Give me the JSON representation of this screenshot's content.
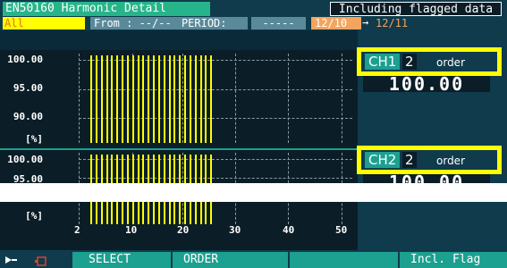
{
  "header": {
    "title": "EN50160 Harmonic Detail",
    "flag_status": "Including flagged data",
    "channel_select": "All",
    "from_label": "From : --/--",
    "period_label": "PERIOD:",
    "period_value": "-----",
    "date_from": "12/10",
    "arrow": "→",
    "date_to": "12/11"
  },
  "graph1": {
    "y_ticks": [
      "100.00",
      "95.00",
      "90.00",
      "[%]"
    ]
  },
  "graph2": {
    "y_ticks": [
      "100.00",
      "95.00",
      "[%]"
    ]
  },
  "x_axis": {
    "ticks": [
      "2",
      "10",
      "20",
      "30",
      "40",
      "50"
    ]
  },
  "ch1": {
    "label": "CH1",
    "order": "2",
    "order_unit": "order",
    "value": "100.00"
  },
  "ch2": {
    "label": "CH2",
    "order": "2",
    "order_unit": "order",
    "value": "100.00"
  },
  "function_bar": {
    "select_label": "SELECT",
    "order_label": "ORDER",
    "blank_label": "",
    "incl_flag_label": "Incl. Flag"
  },
  "colors": {
    "bar": "#ffff00",
    "highlight": "#ffff00",
    "accent": "#1ca090"
  }
}
